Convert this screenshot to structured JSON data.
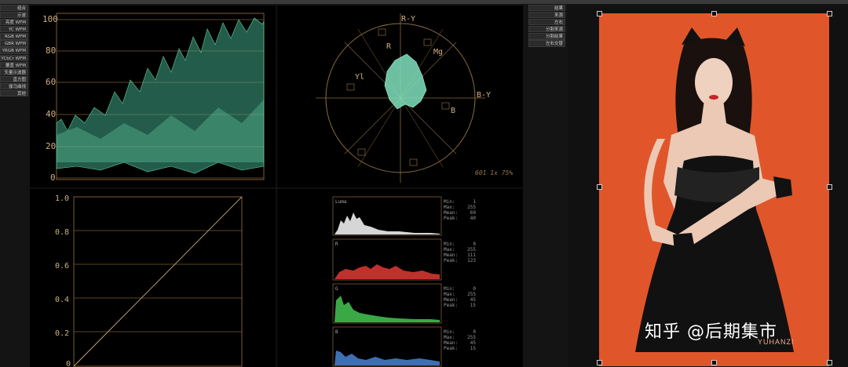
{
  "left_menu": [
    "组合",
    "示波",
    "亮度 WFM",
    "YC WFM",
    "RGB WFM",
    "GBR WFM",
    "YRGB WFM",
    "YCbCr WFM",
    "覆盖 WFM",
    "矢量示波器",
    "直方图",
    "伽马曲线",
    "其他"
  ],
  "right_menu": [
    "结果",
    "来源",
    "左右",
    "分割来源",
    "分割结果",
    "左右交替"
  ],
  "waveform": {
    "ticks": [
      "100",
      "80",
      "60",
      "40",
      "20",
      "0"
    ]
  },
  "vectorscope": {
    "labels": {
      "ry": "R-Y",
      "r": "R",
      "mg": "Mg",
      "by": "B-Y",
      "b": "B",
      "yl": "Yl"
    },
    "footer": "601 1x 75%"
  },
  "gamma": {
    "ticks": [
      "1.0",
      "0.8",
      "0.6",
      "0.4",
      "0.2",
      "0"
    ]
  },
  "histograms": [
    {
      "channel": "Luma",
      "color": "#d6d6d6",
      "stats": [
        "Min:",
        "Max:",
        "Mean:",
        "Peak:"
      ],
      "vals": [
        "1",
        "255",
        "69",
        "40"
      ]
    },
    {
      "channel": "R",
      "color": "#c0302c",
      "stats": [
        "Min:",
        "Max:",
        "Mean:",
        "Peak:"
      ],
      "vals": [
        "0",
        "255",
        "111",
        "123"
      ]
    },
    {
      "channel": "G",
      "color": "#3aa845",
      "stats": [
        "Min:",
        "Max:",
        "Mean:",
        "Peak:"
      ],
      "vals": [
        "0",
        "255",
        "45",
        "15"
      ]
    },
    {
      "channel": "B",
      "color": "#3e6fb4",
      "stats": [
        "Min:",
        "Max:",
        "Mean:",
        "Peak:"
      ],
      "vals": [
        "0",
        "255",
        "45",
        "15"
      ]
    }
  ],
  "preview": {
    "bg": "#e0562a",
    "watermark": "知乎 @后期集市",
    "corner_text": "YUHANZI"
  }
}
